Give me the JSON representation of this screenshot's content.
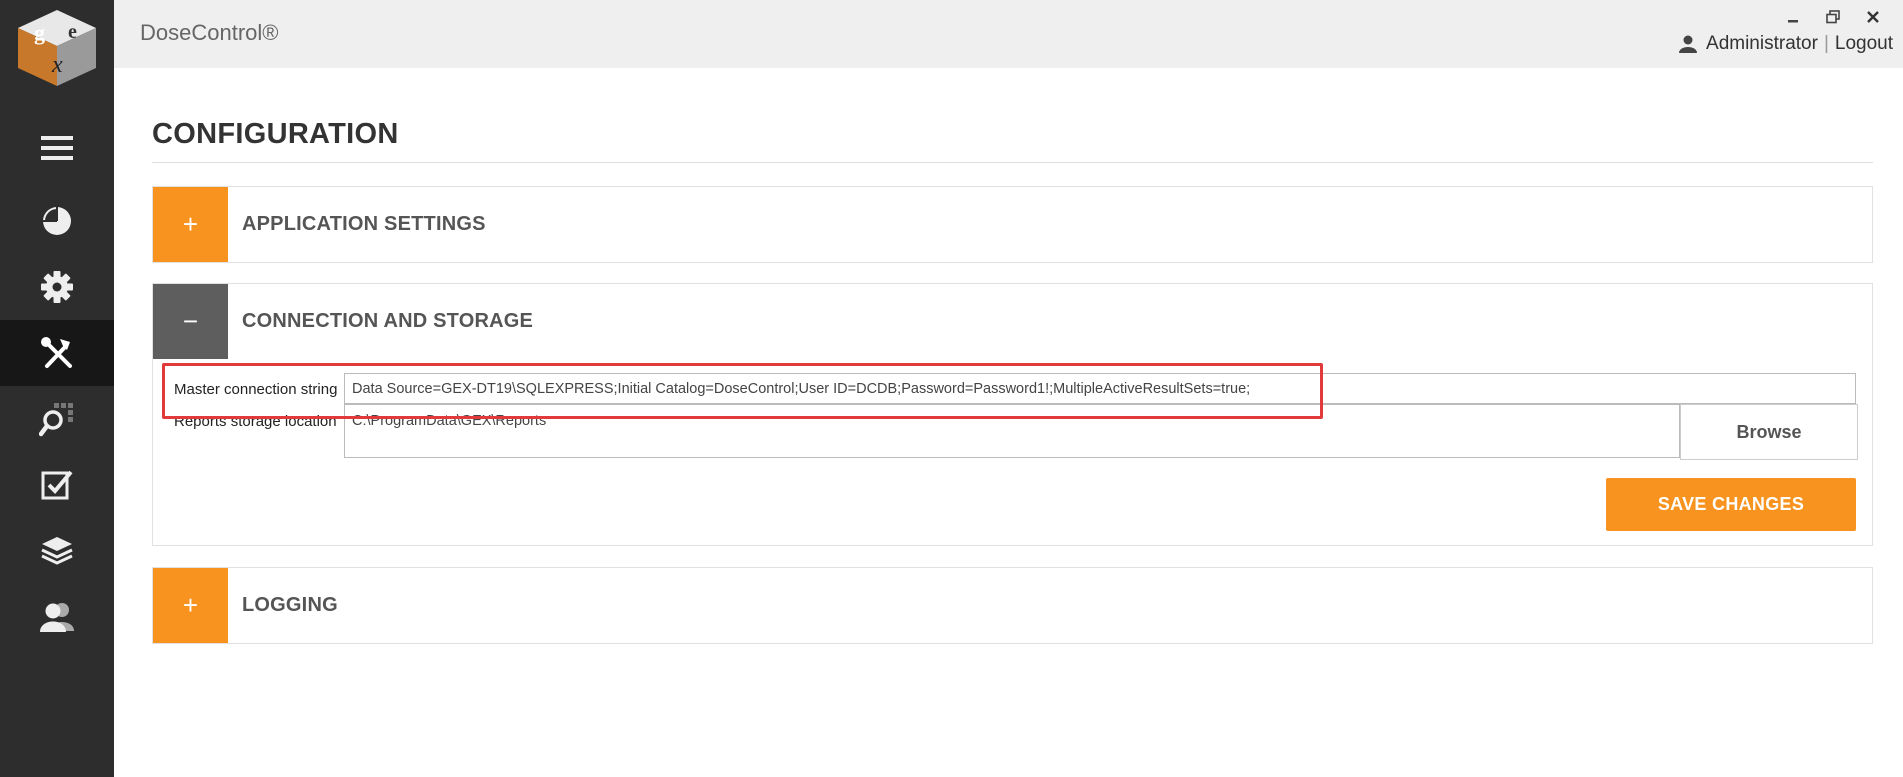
{
  "app": {
    "title": "DoseControl®"
  },
  "window": {
    "minimize": "minimize",
    "restore": "restore",
    "close": "close"
  },
  "user": {
    "name": "Administrator",
    "separator": "|",
    "logout": "Logout"
  },
  "sidebar": {
    "items": [
      {
        "name": "menu",
        "icon": "hamburger-icon",
        "active": false
      },
      {
        "name": "dashboard",
        "icon": "pie-chart-icon",
        "active": false
      },
      {
        "name": "settings",
        "icon": "gear-icon",
        "active": false
      },
      {
        "name": "configuration",
        "icon": "tools-icon",
        "active": true
      },
      {
        "name": "search",
        "icon": "search-grid-icon",
        "active": false
      },
      {
        "name": "tasks",
        "icon": "checkbox-icon",
        "active": false
      },
      {
        "name": "layers",
        "icon": "layers-icon",
        "active": false
      },
      {
        "name": "users",
        "icon": "users-icon",
        "active": false
      }
    ]
  },
  "page": {
    "title": "CONFIGURATION"
  },
  "panels": {
    "application": {
      "title": "APPLICATION SETTINGS",
      "toggle": "+"
    },
    "connection": {
      "title": "CONNECTION AND STORAGE",
      "toggle": "−",
      "master_label": "Master connection string",
      "master_value": "Data Source=GEX-DT19\\SQLEXPRESS;Initial Catalog=DoseControl;User ID=DCDB;Password=Password1!;MultipleActiveResultSets=true;",
      "reports_label": "Reports storage location",
      "reports_value": "C:\\ProgramData\\GEX\\Reports",
      "browse": "Browse",
      "save": "SAVE CHANGES"
    },
    "logging": {
      "title": "LOGGING",
      "toggle": "+"
    }
  },
  "colors": {
    "accent": "#f7931e",
    "sidebar": "#2d2d2d",
    "highlight": "#e03a3a"
  }
}
